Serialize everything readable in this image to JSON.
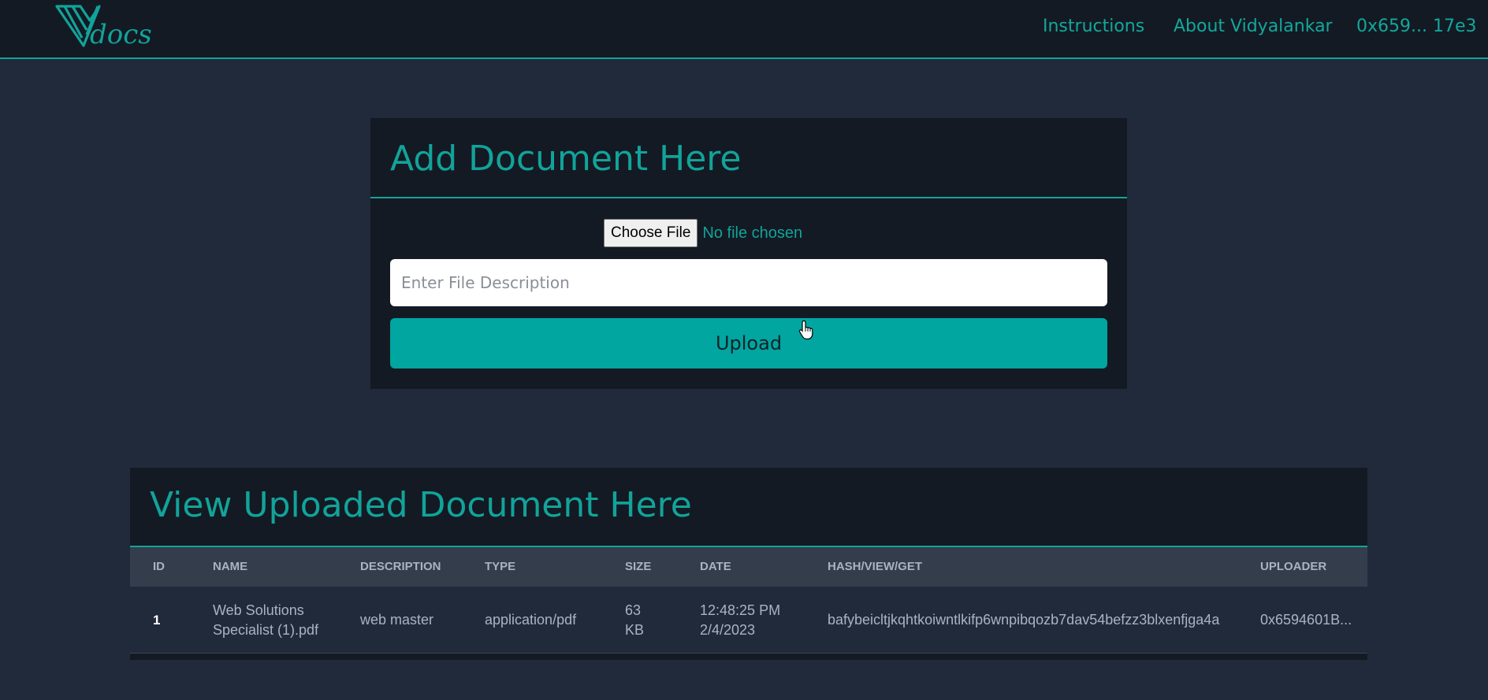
{
  "navbar": {
    "logo_text": "docs",
    "links": {
      "instructions": "Instructions",
      "about": "About Vidyalankar",
      "account": "0x659... 17e3"
    },
    "accent_color": "#12a39a",
    "logo_icon": "v-logo-icon"
  },
  "upload": {
    "title": "Add Document Here",
    "choose_file_label": "Choose File",
    "file_status": "No file chosen",
    "description_placeholder": "Enter File Description",
    "description_value": "",
    "upload_label": "Upload",
    "button_color": "#00a69f"
  },
  "table": {
    "title": "View Uploaded Document Here",
    "headers": [
      "ID",
      "NAME",
      "DESCRIPTION",
      "TYPE",
      "SIZE",
      "DATE",
      "HASH/VIEW/GET",
      "UPLOADER"
    ],
    "rows": [
      {
        "id": "1",
        "name": "Web Solutions Specialist (1).pdf",
        "description": "web master",
        "type": "application/pdf",
        "size": "63 KB",
        "date": "12:48:25 PM 2/4/2023",
        "hash": "bafybeicltjkqhtkoiwntlkifp6wnpibqozb7dav54befzz3blxenfjga4a",
        "uploader": "0x6594601B..."
      }
    ]
  },
  "cursor_icon": "hand-pointer-icon"
}
